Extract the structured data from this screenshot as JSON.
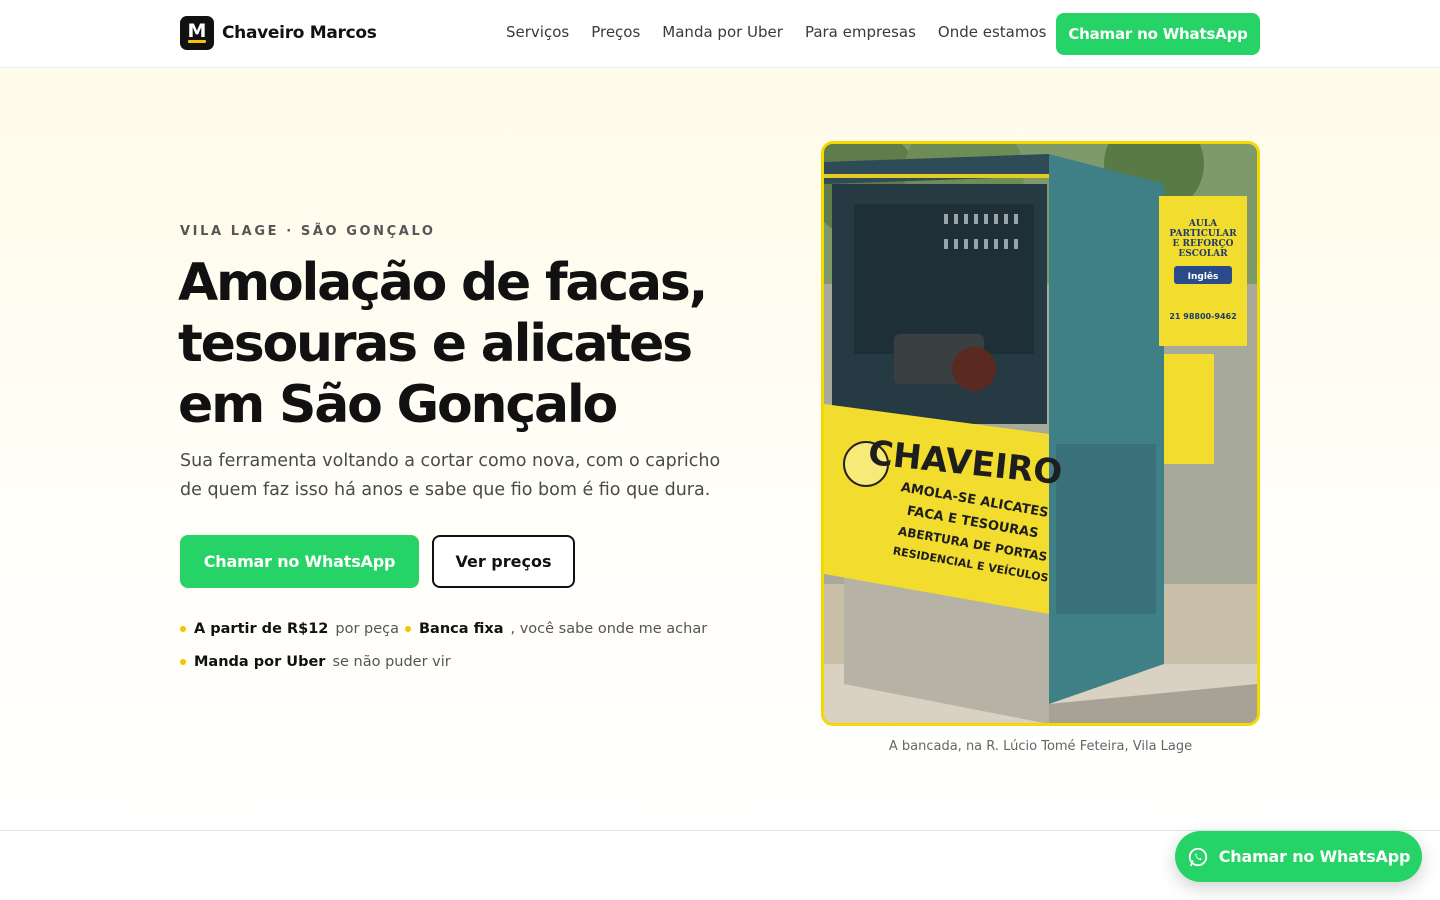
{
  "nav": {
    "logo_letter": "M",
    "brand": "Chaveiro Marcos",
    "links": [
      "Serviços",
      "Preços",
      "Manda por Uber",
      "Para empresas",
      "Onde estamos"
    ],
    "cta": "Chamar no WhatsApp"
  },
  "hero": {
    "eyebrow": "VILA LAGE · SÃO GONÇALO",
    "headline_lines": [
      "Amolação de facas,",
      "tesouras e alicates",
      "em São Gonçalo"
    ],
    "subtitle": "Sua ferramenta voltando a cortar como nova, com o capricho de quem faz isso há anos e sabe que fio bom é fio que dura.",
    "primary_button": "Chamar no WhatsApp",
    "secondary_button": "Ver preços",
    "features": [
      {
        "bold": "A partir de R$12",
        "rest": "por peça"
      },
      {
        "bold": "Banca fixa",
        "rest": ", você sabe onde me achar"
      },
      {
        "bold": "Manda por Uber",
        "rest": "se não puder vir"
      }
    ],
    "photo": {
      "sign_main": "CHAVEIRO",
      "sign_lines": [
        "AMOLA-SE ALICATES",
        "FACA E TESOURAS",
        "ABERTURA DE PORTAS",
        "RESIDENCIAL E VEÍCULOS"
      ],
      "poster_lines": [
        "AULA",
        "PARTICULAR",
        "E REFORÇO",
        "ESCOLAR"
      ],
      "poster_badge": "Inglês",
      "poster_phone": "21 98800-9462",
      "caption": "A bancada, na R. Lúcio Tomé Feteira, Vila Lage"
    }
  },
  "floating_cta": "Chamar no WhatsApp",
  "colors": {
    "whatsapp_green": "#25d366",
    "accent_yellow": "#f5c400",
    "text_dark": "#111111"
  }
}
